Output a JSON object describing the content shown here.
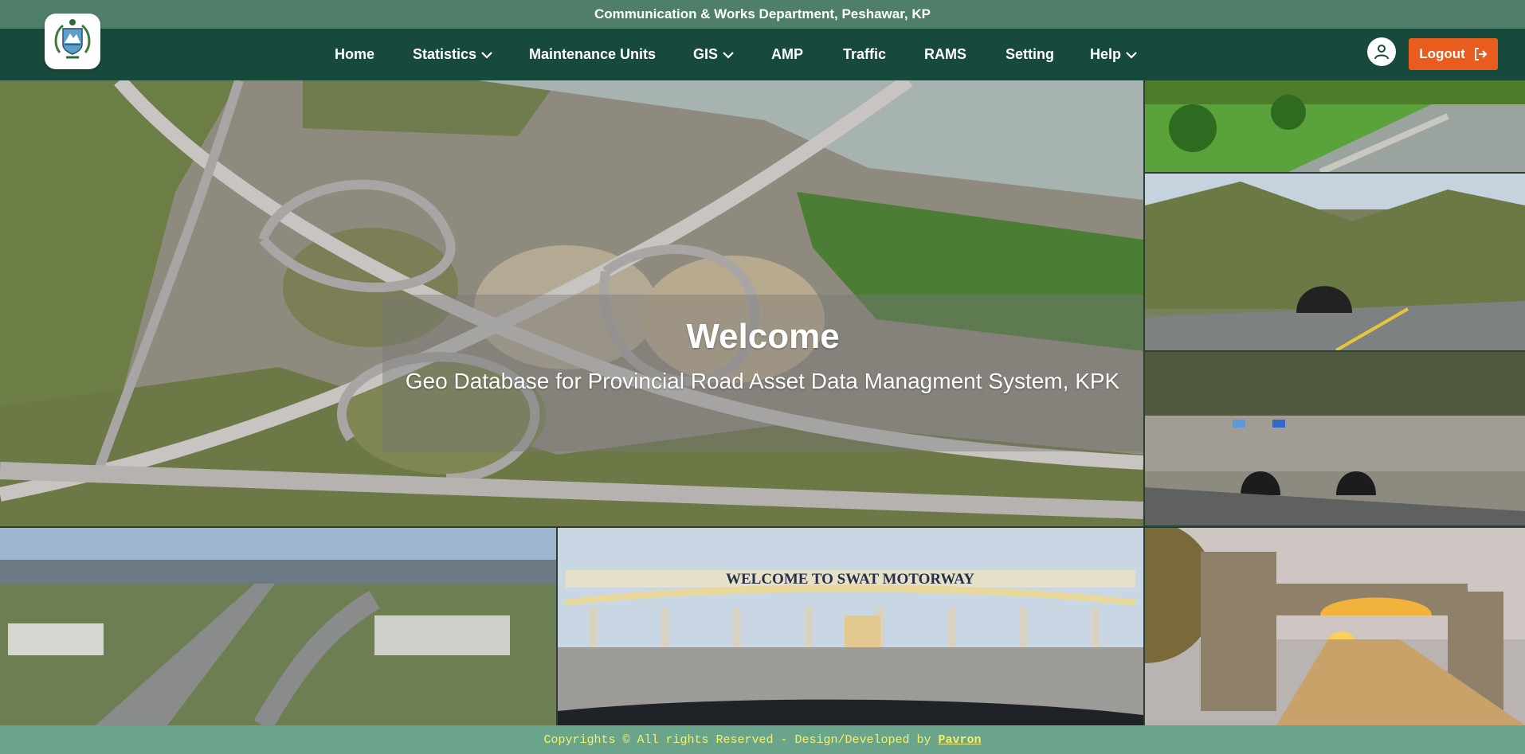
{
  "header": {
    "top_title": "Communication & Works Department, Peshawar, KP"
  },
  "nav": {
    "items": [
      {
        "label": "Home"
      },
      {
        "label": "Statistics"
      },
      {
        "label": "Maintenance Units"
      },
      {
        "label": "GIS"
      },
      {
        "label": "AMP"
      },
      {
        "label": "Traffic"
      },
      {
        "label": "RAMS"
      },
      {
        "label": "Setting"
      },
      {
        "label": "Help"
      }
    ],
    "logout_label": "Logout"
  },
  "hero": {
    "title": "Welcome",
    "subtitle": "Geo Database for Provincial Road Asset Data Managment System, KPK"
  },
  "gallery": {
    "toll_sign": "WELCOME TO SWAT MOTORWAY"
  },
  "footer": {
    "text": "Copyrights © All rights Reserved - Design/Developed by",
    "link": "Pavron"
  },
  "colors": {
    "top_bar": "#4f7f6a",
    "navbar": "#17493c",
    "logout_button": "#e85c1d",
    "footer_bg": "#6aa58b",
    "footer_text": "#f5f06b"
  }
}
